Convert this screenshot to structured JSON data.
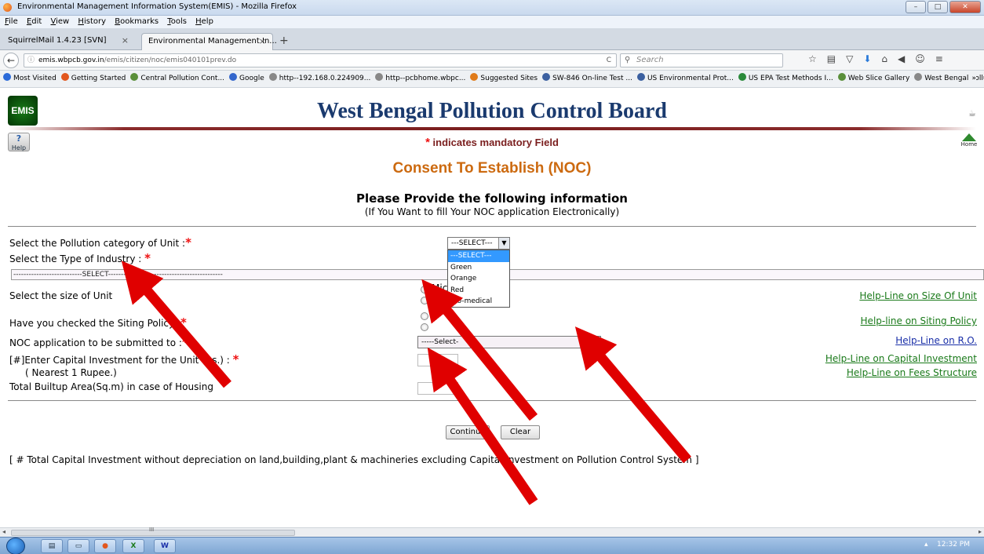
{
  "window": {
    "title": "Environmental Management Information System(EMIS) - Mozilla Firefox",
    "controls": [
      "–",
      "□",
      "✕"
    ]
  },
  "menu": [
    "File",
    "Edit",
    "View",
    "History",
    "Bookmarks",
    "Tools",
    "Help"
  ],
  "tabs": [
    {
      "label": "SquirrelMail 1.4.23 [SVN]",
      "close": "×"
    },
    {
      "label": "Environmental Management In...",
      "close": "×"
    }
  ],
  "new_tab": "+",
  "nav": {
    "back": "←",
    "info": "ⓘ",
    "url_host": "emis.wbpcb.gov.in",
    "url_path": "/emis/citizen/noc/emis040101prev.do",
    "reload": "C",
    "search_placeholder": "Search",
    "search_icon": "⚲",
    "toolbar_icons": [
      "☆",
      "▤",
      "▽",
      "⬇",
      "⌂",
      "◀",
      "☺",
      "≡"
    ]
  },
  "bookmarks": [
    {
      "label": "Most Visited",
      "color": "#2a6ad9"
    },
    {
      "label": "Getting Started",
      "color": "#e2571e"
    },
    {
      "label": "Central Pollution Cont...",
      "color": "#5a8f3a"
    },
    {
      "label": "Google",
      "color": "#3366cc"
    },
    {
      "label": "http--192.168.0.224909...",
      "color": "#888888"
    },
    {
      "label": "http--pcbhome.wbpc...",
      "color": "#888888"
    },
    {
      "label": "Suggested Sites",
      "color": "#e07b1a"
    },
    {
      "label": "SW-846 On-line Test ...",
      "color": "#3a5fa0"
    },
    {
      "label": "US Environmental Prot...",
      "color": "#3a5fa0"
    },
    {
      "label": "US EPA Test Methods I...",
      "color": "#2a8a3a"
    },
    {
      "label": "Web Slice Gallery",
      "color": "#5a8f3a"
    },
    {
      "label": "West Bengal Pollution ...",
      "color": "#888888"
    }
  ],
  "bookmarks_more": "»",
  "page": {
    "logo_text": "EMIS",
    "board_title": "West Bengal Pollution Control Board",
    "help_label": "Help",
    "help_mark": "?",
    "home_label": "Home",
    "mandatory_star": "*",
    "mandatory_text": "indicates mandatory Field",
    "heading": "Consent To Establish (NOC)",
    "provide": "Please Provide the following information",
    "provide_sub": "(If You Want to fill Your NOC application Electronically)"
  },
  "form": {
    "pollution_category_label": "Select the Pollution category of Unit :",
    "pollution_category_value": "---SELECT---",
    "pollution_category_options": [
      "---SELECT---",
      "Green",
      "Orange",
      "Red",
      "Bio-medical"
    ],
    "industry_type_label": "Select the Type of Industry :",
    "industry_type_value": "---------------------------SELECT---------------------------------------------",
    "unit_size_label": "Select the size of Unit",
    "unit_size_option": "Mic",
    "siting_policy_label": "Have you checked the Siting Policy :",
    "noc_submitted_label": "NOC application to be submitted to :",
    "noc_submitted_value": "-----Select-",
    "capital_label": "[#]Enter Capital Investment for the Unit (Rs.) :",
    "capital_note": "( Nearest 1 Rupee.)",
    "builtup_label": "Total Builtup Area(Sq.m) in case of Housing",
    "required_mark": "*"
  },
  "help_links": {
    "size": "Help-Line on Size Of Unit",
    "siting": "Help-line on Siting Policy",
    "ro": "Help-Line on R.O.",
    "capital": "Help-Line on Capital Investment",
    "fees": "Help-Line on Fees Structure"
  },
  "buttons": {
    "continue": "Continue",
    "clear": "Clear"
  },
  "footnote": "[ # Total Capital Investment without depreciation on land,building,plant & machineries excluding Capital Investment on Pollution Control System ]",
  "scroll": {
    "left": "◂",
    "right": "▸",
    "grip": "III"
  },
  "taskbar": {
    "buttons": [
      "▤",
      "▭",
      "●",
      "X",
      "W"
    ],
    "clock": "12:32 PM",
    "tray_arrow": "▴"
  },
  "colors": {
    "title_blue": "#1a3a6e",
    "heading_orange": "#cc6a10",
    "mandatory_red": "#7a1e1e",
    "link_green": "#1a7a1a",
    "link_blue": "#1a2fa8",
    "arrow_red": "#e00000"
  }
}
